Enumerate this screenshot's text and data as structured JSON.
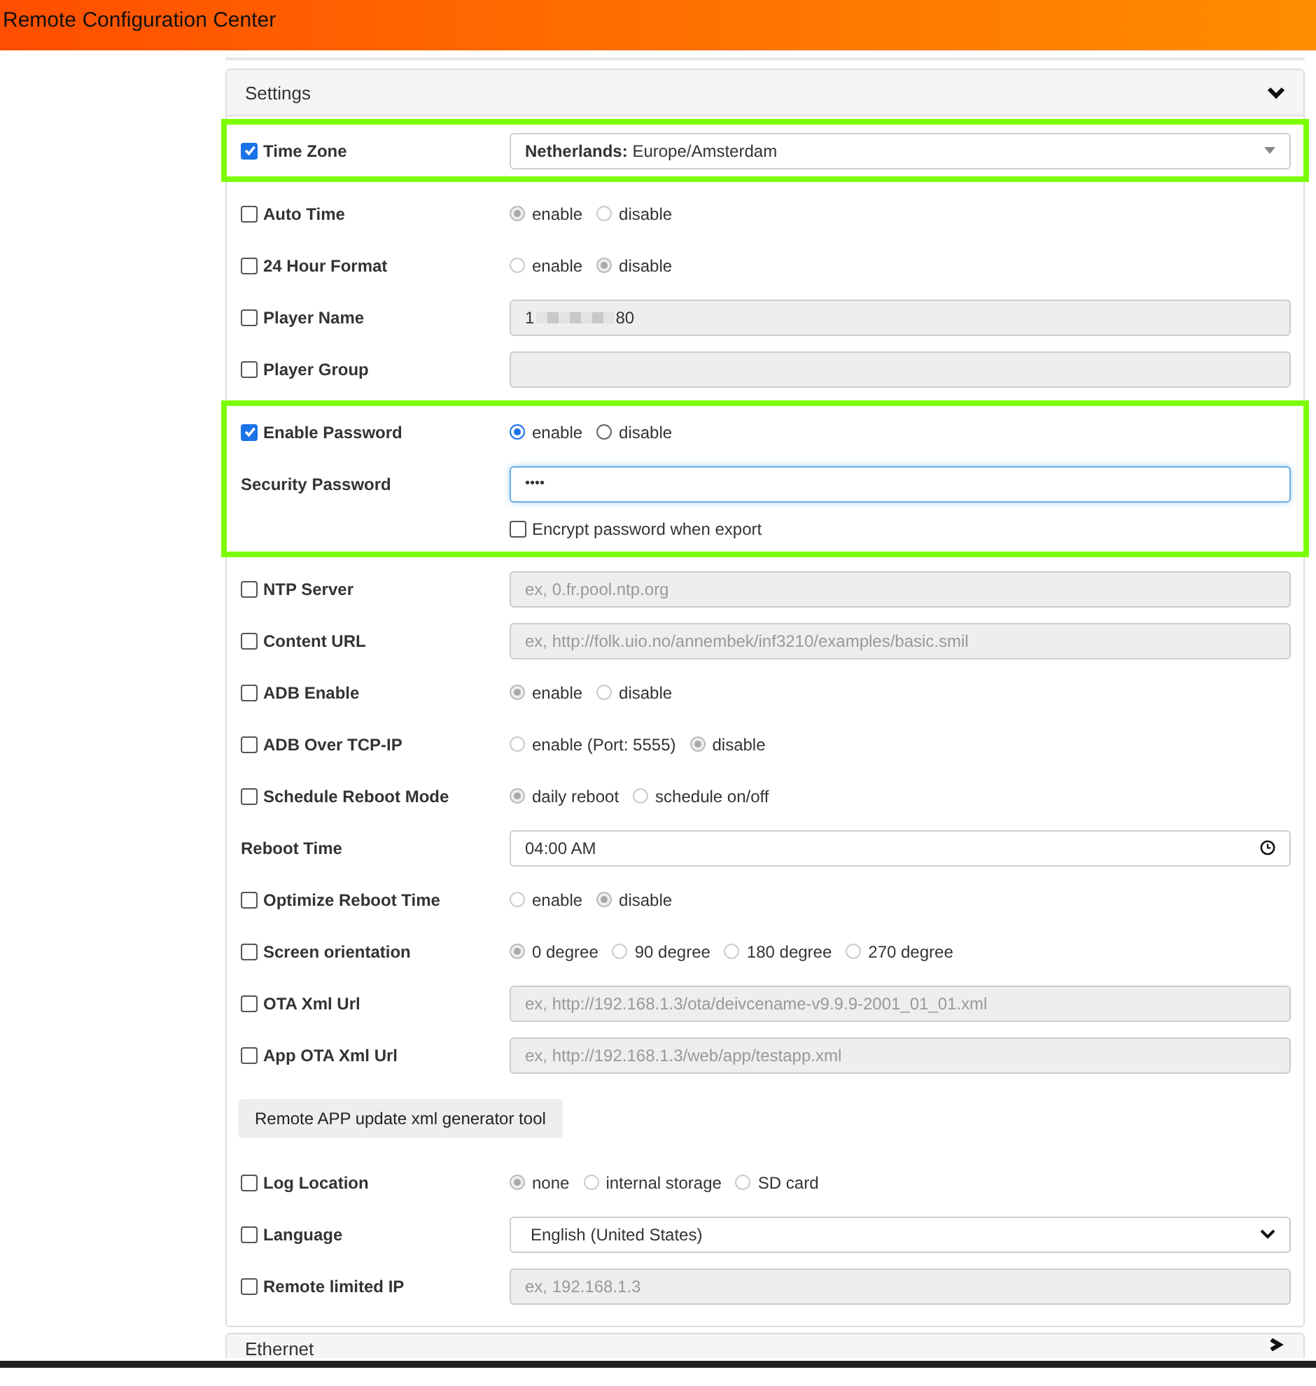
{
  "header": {
    "title": "Remote Configuration Center"
  },
  "settings": {
    "title": "Settings",
    "expanded": true,
    "sections": [
      {
        "highlighted": true,
        "rows": [
          {
            "kind": "select",
            "label": "Time Zone",
            "checked": true,
            "value": "**Netherlands:** Europe/Amsterdam"
          }
        ]
      },
      {
        "highlighted": false,
        "rows": [
          {
            "kind": "radio",
            "label": "Auto Time",
            "checked": false,
            "disabled": true,
            "options": [
              {
                "label": "enable",
                "selected": true
              },
              {
                "label": "disable",
                "selected": false
              }
            ]
          },
          {
            "kind": "radio",
            "label": "24 Hour Format",
            "checked": false,
            "disabled": true,
            "options": [
              {
                "label": "enable",
                "selected": false
              },
              {
                "label": "disable",
                "selected": true
              }
            ]
          },
          {
            "kind": "redacted",
            "label": "Player Name",
            "checked": false,
            "value_start": "1",
            "value_end": "80"
          },
          {
            "kind": "text",
            "label": "Player Group",
            "checked": false,
            "disabled": true
          }
        ]
      },
      {
        "highlighted": true,
        "rows": [
          {
            "kind": "radio",
            "label": "Enable Password",
            "checked": true,
            "disabled": false,
            "options": [
              {
                "label": "enable",
                "selected": true
              },
              {
                "label": "disable",
                "selected": false
              }
            ]
          },
          {
            "kind": "password",
            "label": "Security Password",
            "value": "••••",
            "focused": true
          },
          {
            "kind": "checkbox",
            "label": "Encrypt password when export",
            "checked": false
          }
        ]
      },
      {
        "highlighted": false,
        "rows": [
          {
            "kind": "text",
            "label": "NTP Server",
            "checked": false,
            "disabled": true,
            "placeholder": "ex, 0.fr.pool.ntp.org"
          },
          {
            "kind": "text",
            "label": "Content URL",
            "checked": false,
            "disabled": true,
            "placeholder": "ex, http://folk.uio.no/annembek/inf3210/examples/basic.smil"
          },
          {
            "kind": "radio",
            "label": "ADB Enable",
            "checked": false,
            "disabled": true,
            "options": [
              {
                "label": "enable",
                "selected": true
              },
              {
                "label": "disable",
                "selected": false
              }
            ]
          },
          {
            "kind": "radio",
            "label": "ADB Over TCP-IP",
            "checked": false,
            "disabled": true,
            "options": [
              {
                "label": "enable (Port: 5555)",
                "selected": false
              },
              {
                "label": "disable",
                "selected": true
              }
            ]
          },
          {
            "kind": "radio",
            "label": "Schedule Reboot Mode",
            "checked": false,
            "disabled": true,
            "options": [
              {
                "label": "daily reboot",
                "selected": true
              },
              {
                "label": "schedule on/off",
                "selected": false
              }
            ]
          },
          {
            "kind": "time",
            "label": "Reboot Time",
            "value": "04:00  AM"
          },
          {
            "kind": "radio",
            "label": "Optimize Reboot Time",
            "checked": false,
            "disabled": true,
            "options": [
              {
                "label": "enable",
                "selected": false
              },
              {
                "label": "disable",
                "selected": true
              }
            ]
          },
          {
            "kind": "radio",
            "label": "Screen orientation",
            "checked": false,
            "disabled": true,
            "options": [
              {
                "label": "0 degree",
                "selected": true
              },
              {
                "label": "90 degree",
                "selected": false
              },
              {
                "label": "180 degree",
                "selected": false
              },
              {
                "label": "270 degree",
                "selected": false
              }
            ]
          },
          {
            "kind": "text",
            "label": "OTA Xml Url",
            "checked": false,
            "disabled": true,
            "placeholder": "ex, http://192.168.1.3/ota/deivcename-v9.9.9-2001_01_01.xml"
          },
          {
            "kind": "text",
            "label": "App OTA Xml Url",
            "checked": false,
            "disabled": true,
            "placeholder": "ex, http://192.168.1.3/web/app/testapp.xml"
          },
          {
            "kind": "button",
            "label": "Remote APP update xml generator tool"
          },
          {
            "kind": "radio",
            "label": "Log Location",
            "checked": false,
            "disabled": true,
            "options": [
              {
                "label": "none",
                "selected": true
              },
              {
                "label": "internal storage",
                "selected": false
              },
              {
                "label": "SD card",
                "selected": false
              }
            ]
          },
          {
            "kind": "dropdown",
            "label": "Language",
            "checked": false,
            "value": "English (United States)"
          },
          {
            "kind": "text",
            "label": "Remote limited IP",
            "checked": false,
            "disabled": true,
            "placeholder": "ex, 192.168.1.3"
          }
        ]
      }
    ]
  },
  "ethernet": {
    "title": "Ethernet",
    "expanded": false
  }
}
